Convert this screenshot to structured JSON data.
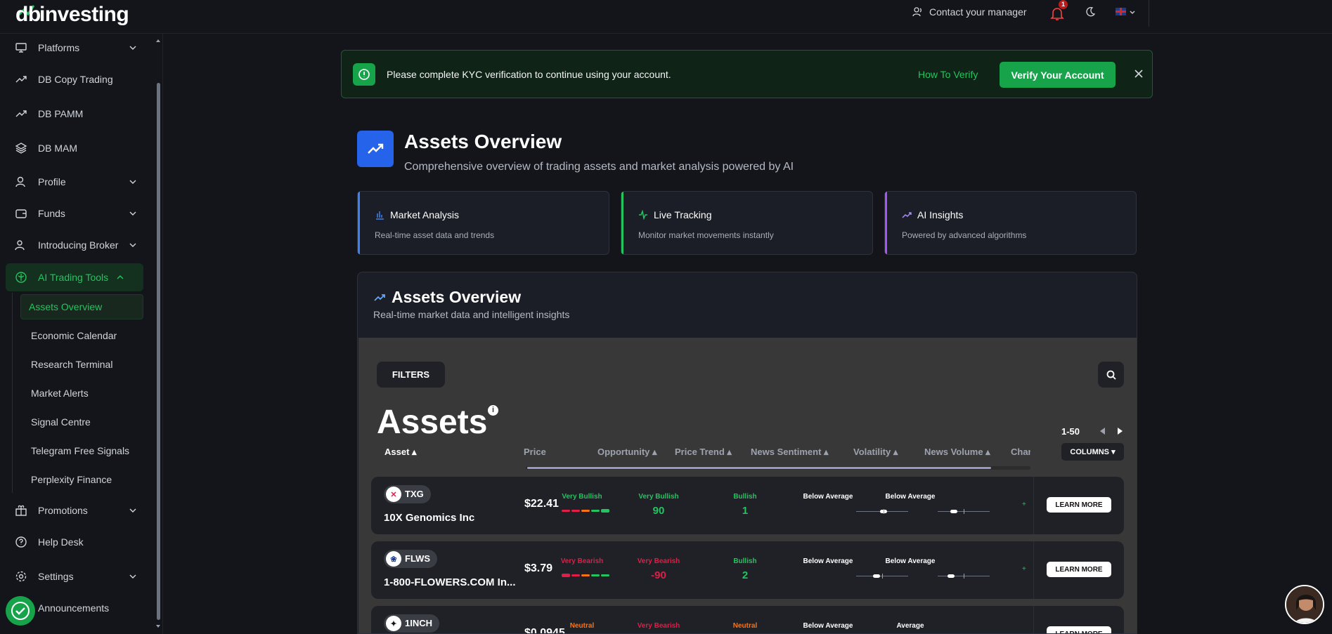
{
  "brand": {
    "logo": "dbinvesting"
  },
  "topbar": {
    "contact_label": "Contact your manager",
    "notif_count": "1"
  },
  "sidebar": {
    "items": [
      {
        "label": "Platforms",
        "icon": "monitor-icon",
        "has_chevron": true
      },
      {
        "label": "DB Copy Trading",
        "icon": "trend-icon"
      },
      {
        "label": "DB PAMM",
        "icon": "trend-icon"
      },
      {
        "label": "DB MAM",
        "icon": "layers-icon"
      },
      {
        "label": "Profile",
        "icon": "user-icon",
        "has_chevron": true
      },
      {
        "label": "Funds",
        "icon": "wallet-icon",
        "has_chevron": true
      },
      {
        "label": "Introducing Broker",
        "icon": "users-icon",
        "has_chevron": true
      },
      {
        "label": "AI Trading Tools",
        "icon": "ai-icon",
        "has_chevron": true,
        "active": true
      },
      {
        "label": "Promotions",
        "icon": "gift-icon",
        "has_chevron": true
      },
      {
        "label": "Help Desk",
        "icon": "help-icon"
      },
      {
        "label": "Settings",
        "icon": "gear-icon",
        "has_chevron": true
      },
      {
        "label": "Announcements",
        "icon": "megaphone-icon"
      }
    ],
    "subitems": [
      "Assets Overview",
      "Economic Calendar",
      "Research Terminal",
      "Market Alerts",
      "Signal Centre",
      "Telegram Free Signals",
      "Perplexity Finance"
    ]
  },
  "kyc": {
    "message": "Please complete KYC verification to continue using your account.",
    "how_label": "How To Verify",
    "verify_label": "Verify Your Account"
  },
  "header": {
    "title": "Assets Overview",
    "subtitle": "Comprehensive overview of trading assets and market analysis powered by AI"
  },
  "cards": [
    {
      "title": "Market Analysis",
      "desc": "Real-time asset data and trends",
      "accent": "#3b82f6"
    },
    {
      "title": "Live Tracking",
      "desc": "Monitor market movements instantly",
      "accent": "#22c55e"
    },
    {
      "title": "AI Insights",
      "desc": "Powered by advanced algorithms",
      "accent": "#a855f7"
    }
  ],
  "panel": {
    "title": "Assets Overview",
    "subtitle": "Real-time market data and intelligent insights",
    "filters_label": "FILTERS",
    "heading": "Assets",
    "pager": "1-50",
    "columns_label": "COLUMNS ▾",
    "columns": [
      "Asset ▴",
      "Price",
      "Opportunity ▴",
      "Price Trend ▴",
      "News Sentiment ▴",
      "Volatility ▴",
      "News Volume ▴",
      "Chan"
    ],
    "learn_label": "LEARN MORE"
  },
  "rows": [
    {
      "ticker": "TXG",
      "name": "10X Genomics Inc",
      "price": "$22.41",
      "opportunity": "Very Bullish",
      "trend_label": "Very Bullish",
      "trend_value": "90",
      "sentiment_label": "Bullish",
      "sentiment_value": "1",
      "volatility": "Below Average",
      "news_volume": "Below Average"
    },
    {
      "ticker": "FLWS",
      "name": "1-800-FLOWERS.COM In...",
      "price": "$3.79",
      "opportunity": "Very Bearish",
      "trend_label": "Very Bearish",
      "trend_value": "-90",
      "sentiment_label": "Bullish",
      "sentiment_value": "2",
      "volatility": "Below Average",
      "news_volume": "Below Average"
    },
    {
      "ticker": "1INCH",
      "name": "",
      "price": "$0.0945",
      "opportunity": "Neutral",
      "trend_label": "Very Bearish",
      "trend_value": "",
      "sentiment_label": "Neutral",
      "sentiment_value": "",
      "volatility": "Below Average",
      "news_volume": "Average"
    }
  ]
}
